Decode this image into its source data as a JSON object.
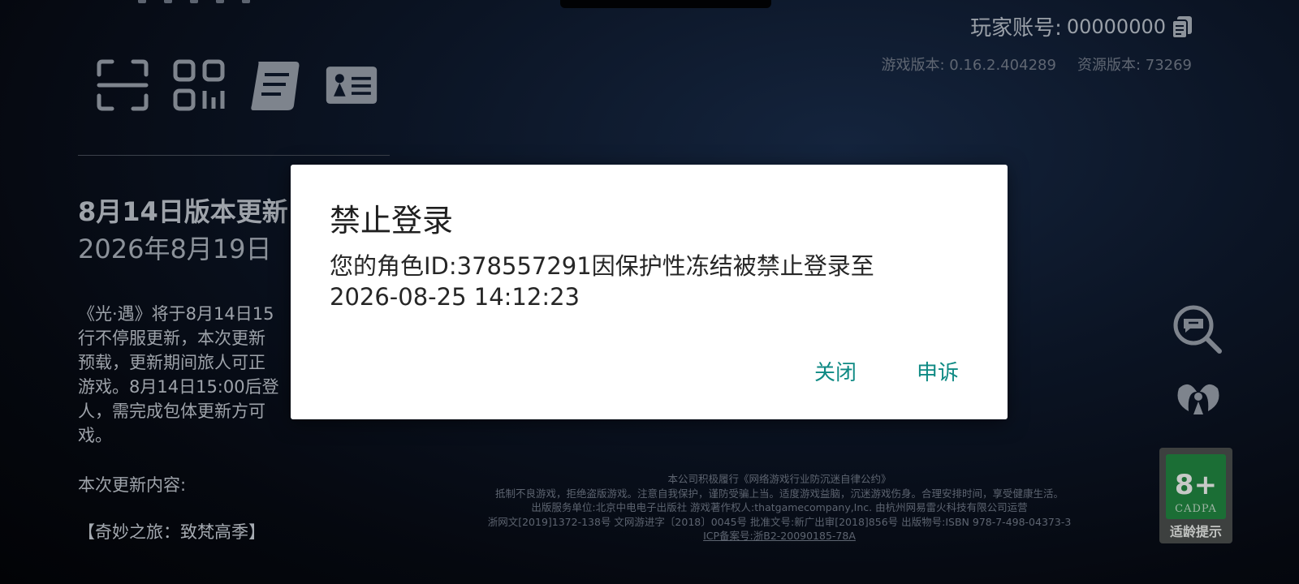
{
  "account": {
    "label": "玩家账号:",
    "value": "00000000"
  },
  "versions": {
    "game": "游戏版本: 0.16.2.404289",
    "resource": "资源版本: 73269"
  },
  "announcement": {
    "title": "8月14日版本更新",
    "date": "2026年8月19日",
    "body_lines": [
      "《光·遇》将于8月14日15",
      "行不停服更新，本次更新",
      "预载，更新期间旅人可正",
      "游戏。8月14日15:00后登",
      "人，需完成包体更新方可",
      "戏。"
    ],
    "content_heading": "本次更新内容:",
    "section": "【奇妙之旅：致梵高季】"
  },
  "footer": {
    "line1": "本公司积极履行《网络游戏行业防沉迷自律公约》",
    "line2": "抵制不良游戏，拒绝盗版游戏。注意自我保护，谨防受骗上当。适度游戏益脑，沉迷游戏伤身。合理安排时间，享受健康生活。",
    "line3": "出版服务单位:北京中电电子出版社 游戏著作权人:thatgamecompany,Inc. 由杭州网易雷火科技有限公司运营",
    "line4": "浙网文[2019]1372-138号 文网游进字〔2018〕0045号 批准文号:新广出审[2018]856号 出版物号:ISBN 978-7-498-04373-3",
    "icp": "ICP备案号:浙B2-20090185-78A"
  },
  "age_badge": {
    "rating": "8+",
    "org": "CADPA",
    "tip": "适龄提示"
  },
  "dialog": {
    "title": "禁止登录",
    "message_line1": "您的角色ID:378557291因保护性冻结被禁止登录至",
    "message_line2": "2026-08-25 14:12:23",
    "close_label": "关闭",
    "appeal_label": "申诉"
  },
  "icons": {
    "top_left": [
      "scan-icon",
      "qr-code-icon",
      "notice-scroll-icon",
      "id-card-icon"
    ],
    "right": [
      "search-message-icon",
      "child-guardian-icon"
    ],
    "copy": "copy-icon"
  },
  "colors": {
    "dialog_accent": "#0f8a84",
    "age_green": "#1b6e35"
  }
}
